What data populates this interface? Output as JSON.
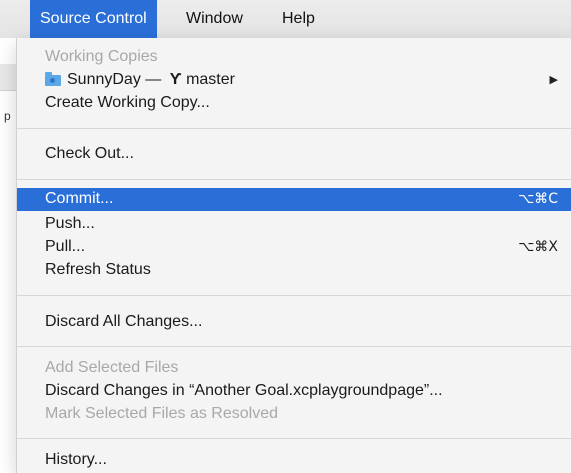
{
  "menubar": {
    "items": [
      "Source Control",
      "Window",
      "Help"
    ]
  },
  "menu": {
    "working_copies_header": "Working Copies",
    "repo_name": "SunnyDay",
    "repo_dash": "—",
    "branch_name": "master",
    "create_working_copy": "Create Working Copy...",
    "check_out": "Check Out...",
    "commit": "Commit...",
    "commit_shortcut": "⌥⌘C",
    "push": "Push...",
    "pull": "Pull...",
    "pull_shortcut": "⌥⌘X",
    "refresh_status": "Refresh Status",
    "discard_all": "Discard All Changes...",
    "add_selected": "Add Selected Files",
    "discard_changes_in": "Discard Changes in “Another Goal.xcplaygroundpage”...",
    "mark_resolved": "Mark Selected Files as Resolved",
    "history": "History..."
  },
  "behind": {
    "edge_char": "p"
  },
  "colors": {
    "highlight": "#2a6fd8",
    "disabled": "#a8a8a8"
  }
}
